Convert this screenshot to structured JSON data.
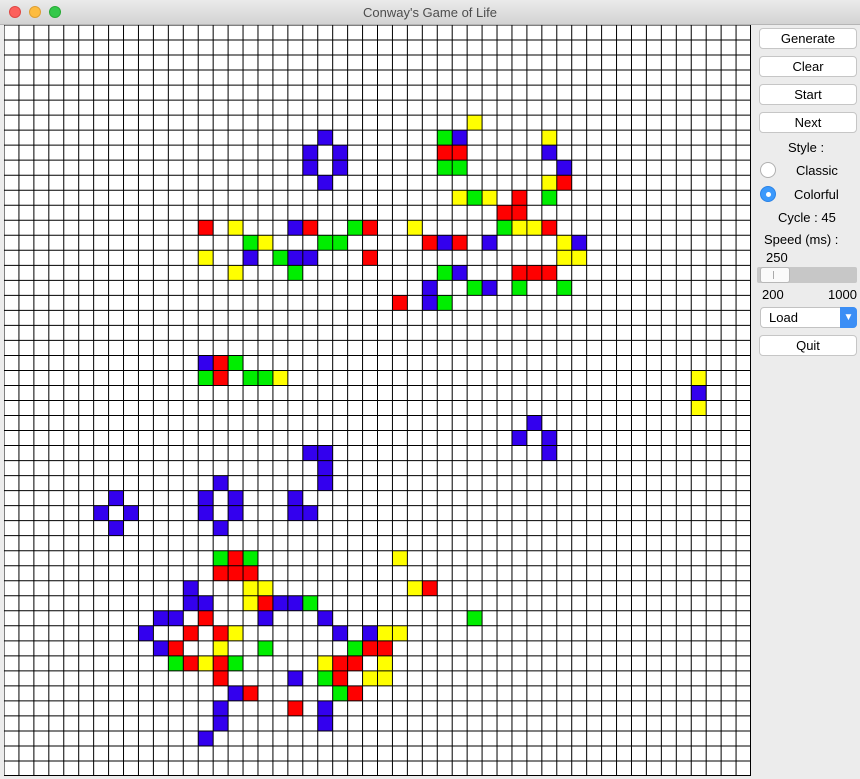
{
  "window": {
    "title": "Conway's Game of Life"
  },
  "controls": {
    "generate_label": "Generate",
    "clear_label": "Clear",
    "start_label": "Start",
    "next_label": "Next",
    "style_label": "Style :",
    "classic_label": "Classic",
    "colorful_label": "Colorful",
    "selected_style": "Colorful",
    "cycle_text": "Cycle : 45",
    "speed_label": "Speed (ms) :",
    "speed_value": "250",
    "slider_min": "200",
    "slider_max": "1000",
    "load_label": "Load",
    "quit_label": "Quit"
  },
  "colors": {
    "R": "#ff0000",
    "G": "#00ee00",
    "B": "#3300ee",
    "Y": "#ffff00"
  },
  "grid": {
    "cols": 50,
    "row_count": 50,
    "rows": [
      "..................................................",
      "..................................................",
      "..................................................",
      "..................................................",
      "..................................................",
      "..................................................",
      "...............................Y..................",
      ".....................B.......GB.....Y..............",
      "....................B.B......RR.....B.............",
      "....................B.B......GG......B............",
      ".....................B..............YR............",
      "..............................YGY.R.G.............",
      ".................................RR................",
      ".............R.Y...BR..GR..Y.....GYYR.............",
      "................GY...GG.....RBR.B....YB...........",
      ".............Y..B.GBB...R............YY............",
      "...............Y...G.........GB...RRR.............",
      "............................B..GB.G..G............",
      "..........................R.BG....................",
      "..................................................",
      "..................................................",
      "..................................................",
      ".............BRG..................................",
      ".............GR.GGY...........................Y...",
      "..............................................B...",
      "..............................................Y...",
      "...................................B..............",
      "..................................B.B.............",
      "....................BB..............B.............",
      ".....................B............................",
      "..............B......B............................",
      ".......B.....B.B...B..............................",
      "......B.B....B.B...BB.............................",
      ".......B......B...................................",
      "..................................................",
      "..............GRG.........Y.......................",
      "..............RRR.................................",
      "............B...YY.........YR.....................",
      "............BB..YRBBG.............................",
      "..........BB.R...B...B.........G..................",
      ".........B..R.RY......B.BYY.......................",
      "..........BR..Y..G.....GRR........................",
      "...........GRYRG.....YRR.Y........................",
      "..............R....B.GR.YY........................",
      "...............BR.....GR..........................",
      "..............B....R.B............................",
      "..............B......B............................",
      ".............B.....................................",
      "..................................................",
      ".................................................."
    ]
  }
}
